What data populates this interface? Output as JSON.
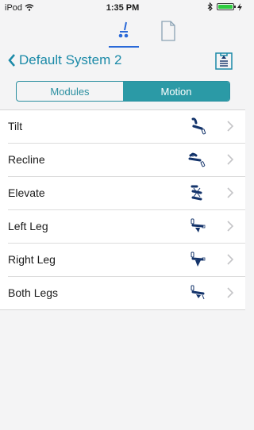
{
  "status": {
    "device": "iPod",
    "time": "1:35 PM"
  },
  "nav": {
    "back_label": "Default System 2"
  },
  "segments": {
    "modules": "Modules",
    "motion": "Motion"
  },
  "colors": {
    "accent": "#2b9aa6",
    "link": "#1b8aa8",
    "tab_indicator": "#2a69d8",
    "icon_navy": "#14346b"
  },
  "list": {
    "items": [
      {
        "label": "Tilt",
        "icon": "tilt-icon"
      },
      {
        "label": "Recline",
        "icon": "recline-icon"
      },
      {
        "label": "Elevate",
        "icon": "elevate-icon"
      },
      {
        "label": "Left Leg",
        "icon": "left-leg-icon"
      },
      {
        "label": "Right Leg",
        "icon": "right-leg-icon"
      },
      {
        "label": "Both Legs",
        "icon": "both-legs-icon"
      }
    ]
  }
}
